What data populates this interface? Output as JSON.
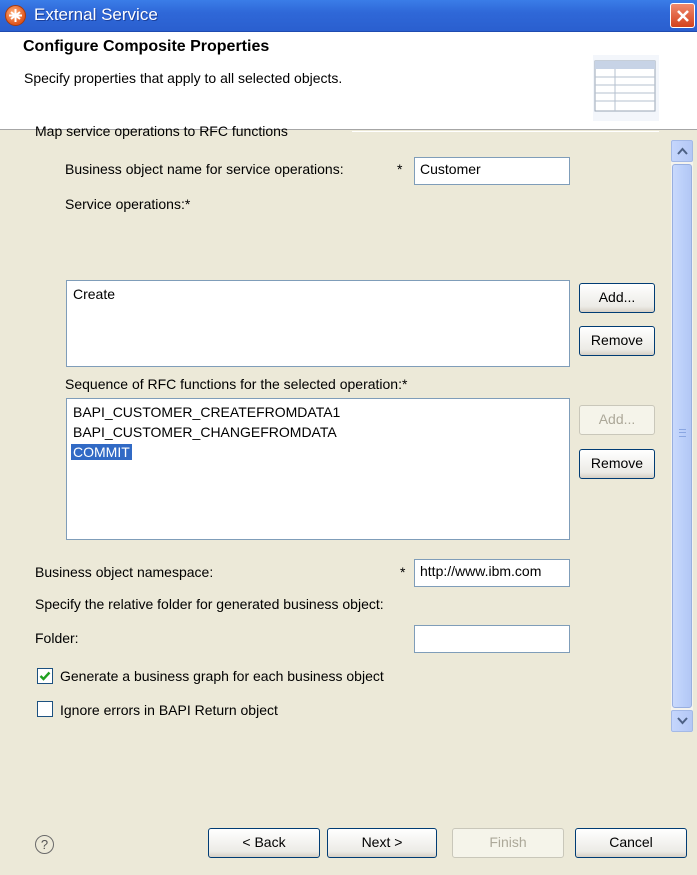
{
  "window": {
    "title": "External Service"
  },
  "header": {
    "title": "Configure Composite Properties",
    "description": "Specify properties that apply to all selected objects."
  },
  "group": {
    "title": "Map service operations to RFC functions"
  },
  "fields": {
    "bo_name_label": "Business object name for service operations:",
    "bo_name_value": "Customer",
    "required_mark": "*",
    "service_ops_label": "Service operations:*",
    "service_ops": [
      "Create"
    ],
    "rfc_seq_label": "Sequence of RFC functions for the selected operation:*",
    "rfc_functions": [
      "BAPI_CUSTOMER_CREATEFROMDATA1",
      "BAPI_CUSTOMER_CHANGEFROMDATA",
      "COMMIT"
    ],
    "rfc_selected": "COMMIT",
    "namespace_label": "Business object namespace:",
    "namespace_value": "http://www.ibm.com",
    "folder_hint": "Specify the relative folder for generated business object:",
    "folder_label": "Folder:",
    "folder_value": ""
  },
  "buttons": {
    "add": "Add...",
    "remove": "Remove",
    "back": "< Back",
    "next": "Next >",
    "finish": "Finish",
    "cancel": "Cancel"
  },
  "checkboxes": {
    "business_graph": {
      "label": "Generate a business graph for each business object",
      "checked": true
    },
    "ignore_errors": {
      "label": "Ignore errors in BAPI Return object",
      "checked": false
    }
  },
  "icons": {
    "app": "eclipse-wizard-icon",
    "close": "close-icon",
    "banner": "table-wizard-banner-icon",
    "help": "help-icon"
  }
}
